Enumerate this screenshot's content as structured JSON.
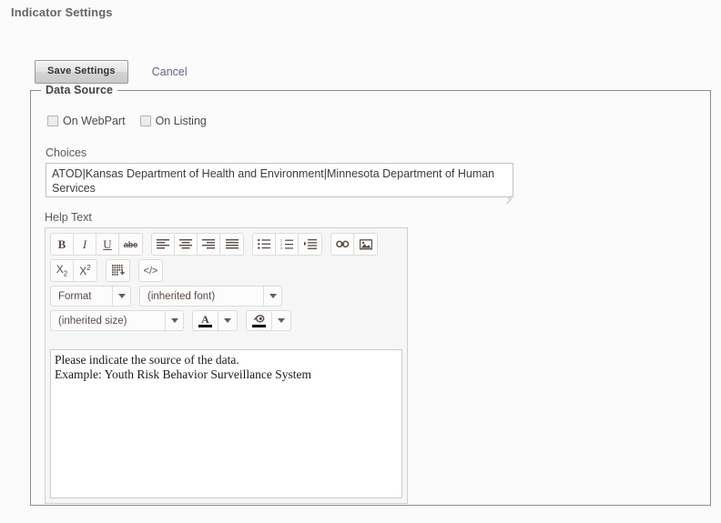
{
  "page": {
    "title": "Indicator Settings"
  },
  "actions": {
    "save_label": "Save Settings",
    "cancel_label": "Cancel"
  },
  "data_source": {
    "legend": "Data Source",
    "checkboxes": [
      {
        "label": "On WebPart",
        "checked": false
      },
      {
        "label": "On Listing",
        "checked": false
      }
    ],
    "choices": {
      "label": "Choices",
      "value": "ATOD|Kansas Department of Health and Environment|Minnesota Department of Human Services",
      "placeholder": ""
    },
    "help_text": {
      "label": "Help Text",
      "toolbar": {
        "row1": [
          {
            "name": "bold-icon",
            "label": "B"
          },
          {
            "name": "italic-icon",
            "label": "I"
          },
          {
            "name": "underline-icon",
            "label": "U"
          },
          {
            "name": "strikethrough-icon",
            "label": "abc"
          },
          {
            "name": "align-left-icon",
            "label": "Align Left"
          },
          {
            "name": "align-center-icon",
            "label": "Align Center"
          },
          {
            "name": "align-right-icon",
            "label": "Align Right"
          },
          {
            "name": "align-justify-icon",
            "label": "Justify"
          },
          {
            "name": "bullet-list-icon",
            "label": "Bullet List"
          },
          {
            "name": "numbered-list-icon",
            "label": "Numbered List"
          },
          {
            "name": "indent-icon",
            "label": "Indent"
          },
          {
            "name": "link-icon",
            "label": "Insert Link"
          },
          {
            "name": "image-icon",
            "label": "Insert Image"
          }
        ],
        "row2": [
          {
            "name": "subscript-icon",
            "label": "X2"
          },
          {
            "name": "superscript-icon",
            "label": "X2"
          },
          {
            "name": "insert-table-icon",
            "label": "Insert Table"
          },
          {
            "name": "source-code-icon",
            "label": "</>"
          }
        ],
        "format_select": "Format",
        "font_select": "(inherited font)",
        "size_select": "(inherited size)",
        "text_color_label": "A",
        "highlight_color_label": "Highlight",
        "text_color": "#000000",
        "highlight_color": "#000000"
      },
      "content_lines": [
        "Please indicate the source of the data.",
        "Example: Youth Risk Behavior Surveillance System"
      ]
    }
  }
}
